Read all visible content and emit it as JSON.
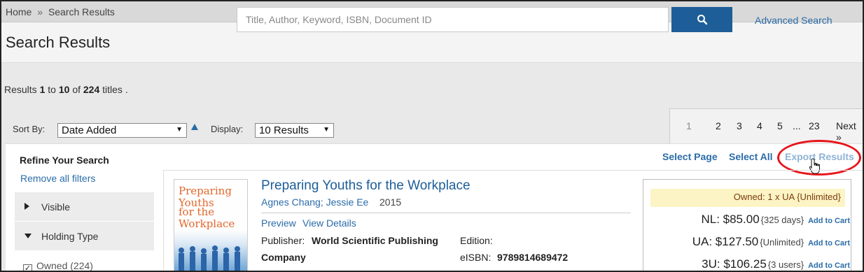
{
  "breadcrumb": {
    "home": "Home",
    "separator": "»",
    "current": "Search Results"
  },
  "header": {
    "title": "Search Results",
    "search_placeholder": "Title, Author, Keyword, ISBN, Document ID",
    "search_icon": "search-icon",
    "advanced_search": "Advanced Search"
  },
  "results": {
    "prefix": "Results",
    "from": "1",
    "to_word": "to",
    "to": "10",
    "of_word": "of",
    "total": "224",
    "suffix": "titles ."
  },
  "sort": {
    "label": "Sort By:",
    "selected": "Date Added",
    "direction_icon": "sort-ascending-icon"
  },
  "display": {
    "label": "Display:",
    "selected": "10 Results"
  },
  "pagination": {
    "pages": [
      "1",
      "2",
      "3",
      "4",
      "5",
      "...",
      "23"
    ],
    "current": "1",
    "next": "Next »"
  },
  "refine": {
    "title": "Refine Your Search",
    "remove_all": "Remove all filters",
    "facets": [
      {
        "label": "Visible",
        "expanded": false
      },
      {
        "label": "Holding Type",
        "expanded": true
      }
    ],
    "owned_option": "Owned (224)"
  },
  "actions": {
    "select_page": "Select Page",
    "select_all": "Select All",
    "export": "Export Results"
  },
  "result": {
    "title": "Preparing Youths for the Workplace",
    "authors": "Agnes Chang; Jessie Ee",
    "year": "2015",
    "preview": "Preview",
    "view_details": "View Details",
    "publisher_label": "Publisher:",
    "publisher": "World Scientific Publishing",
    "publisher_cont": "Company",
    "edition_label": "Edition:",
    "eisbn_label": "eISBN:",
    "eisbn": "9789814689472",
    "cover_line1": "Preparing Youths",
    "cover_line2": "for the Workplace"
  },
  "pricing": {
    "owned": "Owned: 1 x UA {Unlimited}",
    "rows": [
      {
        "price": "NL: $85.00",
        "duration": "{325 days}",
        "cart": "Add to Cart"
      },
      {
        "price": "UA: $127.50",
        "duration": "{Unlimited}",
        "cart": "Add to Cart"
      },
      {
        "price": "3U: $106.25",
        "duration": "{3 users}",
        "cart": "Add to Cart"
      }
    ]
  },
  "colors": {
    "accent": "#1d5e98",
    "link": "#2a6ca8",
    "highlight_ring": "#e8141b",
    "owned_bg": "#fcf4c4"
  }
}
